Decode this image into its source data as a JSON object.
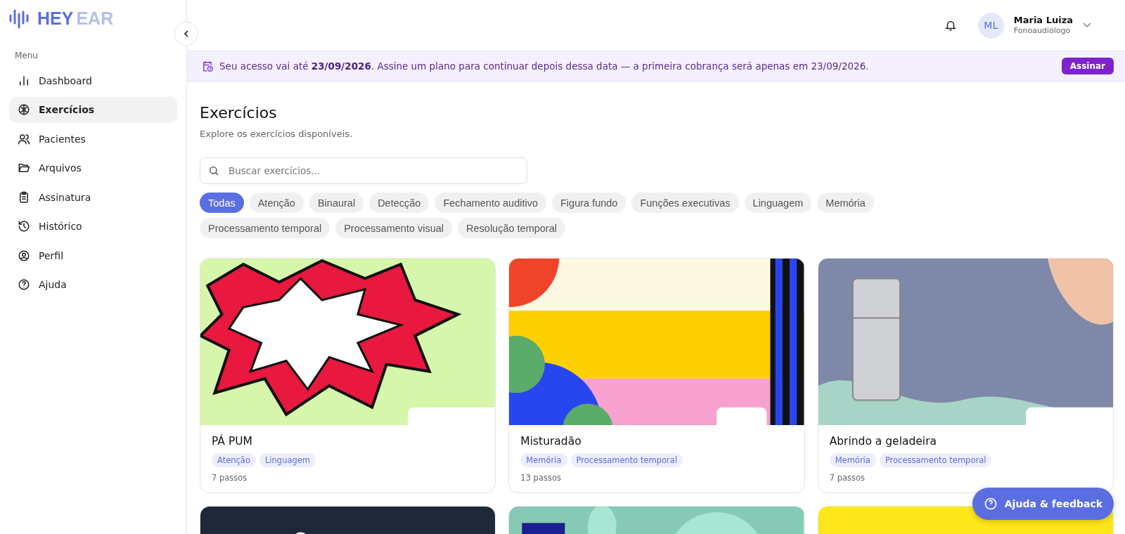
{
  "brand": {
    "part_1": "HEY",
    "part_2": "EAR"
  },
  "sidebar": {
    "heading": "Menu",
    "items": [
      {
        "label": "Dashboard",
        "selected": false
      },
      {
        "label": "Exercícios",
        "selected": true
      },
      {
        "label": "Pacientes",
        "selected": false
      },
      {
        "label": "Arquivos",
        "selected": false
      },
      {
        "label": "Assinatura",
        "selected": false
      },
      {
        "label": "Histórico",
        "selected": false
      },
      {
        "label": "Perfil",
        "selected": false
      },
      {
        "label": "Ajuda",
        "selected": false
      }
    ]
  },
  "user": {
    "initials": "ML",
    "name": "Maria Luiza",
    "role": "Fonoaudiólogo"
  },
  "banner": {
    "text": "Seu acesso vai até **23/09/2026**. Assine um plano para continuar depois dessa data — a primeira cobrança será apenas em 23/09/2026.",
    "button": "Assinar"
  },
  "page": {
    "title": "Exercícios",
    "subtitle": "Explore os exercícios disponíveis."
  },
  "search": {
    "placeholder": "Buscar exercícios..."
  },
  "filters": [
    {
      "label": "Todas",
      "selected": true
    },
    {
      "label": "Atenção",
      "selected": false
    },
    {
      "label": "Binaural",
      "selected": false
    },
    {
      "label": "Detecção",
      "selected": false
    },
    {
      "label": "Fechamento auditivo",
      "selected": false
    },
    {
      "label": "Figura fundo",
      "selected": false
    },
    {
      "label": "Funções executivas",
      "selected": false
    },
    {
      "label": "Linguagem",
      "selected": false
    },
    {
      "label": "Memória",
      "selected": false
    },
    {
      "label": "Processamento temporal",
      "selected": false
    },
    {
      "label": "Processamento visual",
      "selected": false
    },
    {
      "label": "Resolução temporal",
      "selected": false
    }
  ],
  "cards": [
    {
      "kind": "exercise",
      "title": "PÁ PUM",
      "tags": [
        "Atenção",
        "Linguagem"
      ],
      "steps": "7 passos"
    },
    {
      "kind": "exercise",
      "title": "Misturadão",
      "tags": [
        "Memória",
        "Processamento temporal"
      ],
      "steps": "13 passos"
    },
    {
      "kind": "exercise",
      "title": "Abrindo a geladeira",
      "tags": [
        "Memória",
        "Processamento temporal"
      ],
      "steps": "7 passos"
    },
    {
      "kind": "picture"
    },
    {
      "kind": "picture"
    },
    {
      "kind": "picture"
    }
  ],
  "help_button": "Ajuda & feedback"
}
